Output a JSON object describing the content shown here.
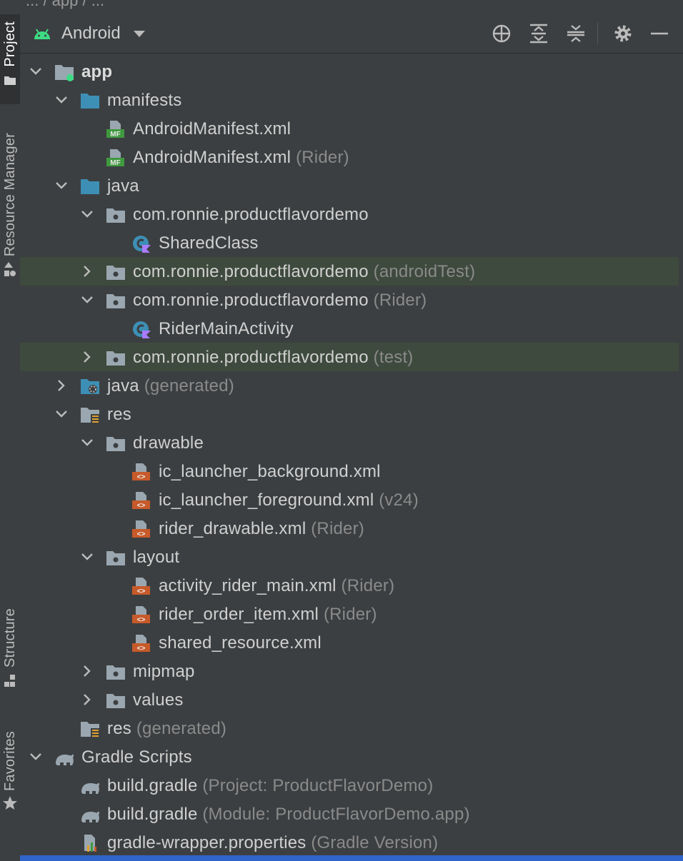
{
  "sidebar": {
    "tabs": [
      {
        "label": "Project",
        "icon": "folder-icon",
        "active": true
      },
      {
        "label": "Resource Manager",
        "icon": "resource-manager-icon",
        "active": false
      },
      {
        "label": "Structure",
        "icon": "structure-icon",
        "active": false
      },
      {
        "label": "Favorites",
        "icon": "star-icon",
        "active": false
      }
    ]
  },
  "breadcrumb": {
    "text": "... / app / ..."
  },
  "header": {
    "view_mode": "Android",
    "icons": [
      "locate-icon",
      "expand-all-icon",
      "collapse-all-icon",
      "settings-icon",
      "minimize-icon"
    ]
  },
  "tree": {
    "rows": [
      {
        "label": "app",
        "hint": "",
        "expanded": true,
        "bold": true,
        "icon": "module-folder-icon"
      },
      {
        "label": "manifests",
        "hint": "",
        "expanded": true,
        "icon": "folder-icon"
      },
      {
        "label": "AndroidManifest.xml",
        "hint": "",
        "icon": "manifest-file-icon"
      },
      {
        "label": "AndroidManifest.xml",
        "hint": "(Rider)",
        "icon": "manifest-file-icon"
      },
      {
        "label": "java",
        "hint": "",
        "expanded": true,
        "icon": "folder-icon"
      },
      {
        "label": "com.ronnie.productflavordemo",
        "hint": "",
        "expanded": true,
        "icon": "package-icon"
      },
      {
        "label": "SharedClass",
        "hint": "",
        "icon": "kotlin-class-icon"
      },
      {
        "label": "com.ronnie.productflavordemo",
        "hint": "(androidTest)",
        "expanded": false,
        "icon": "package-icon",
        "highlight": true
      },
      {
        "label": "com.ronnie.productflavordemo",
        "hint": "(Rider)",
        "expanded": true,
        "icon": "package-icon"
      },
      {
        "label": "RiderMainActivity",
        "hint": "",
        "icon": "kotlin-class-icon"
      },
      {
        "label": "com.ronnie.productflavordemo",
        "hint": "(test)",
        "expanded": false,
        "icon": "package-icon",
        "highlight": true
      },
      {
        "label": "java",
        "hint": "(generated)",
        "expanded": false,
        "icon": "generated-folder-icon"
      },
      {
        "label": "res",
        "hint": "",
        "expanded": true,
        "icon": "resource-folder-icon"
      },
      {
        "label": "drawable",
        "hint": "",
        "expanded": true,
        "icon": "package-icon"
      },
      {
        "label": "ic_launcher_background.xml",
        "hint": "",
        "icon": "xml-file-icon"
      },
      {
        "label": "ic_launcher_foreground.xml",
        "hint": "(v24)",
        "icon": "xml-file-icon"
      },
      {
        "label": "rider_drawable.xml",
        "hint": "(Rider)",
        "icon": "xml-file-icon"
      },
      {
        "label": "layout",
        "hint": "",
        "expanded": true,
        "icon": "package-icon"
      },
      {
        "label": "activity_rider_main.xml",
        "hint": "(Rider)",
        "icon": "xml-file-icon"
      },
      {
        "label": "rider_order_item.xml",
        "hint": "(Rider)",
        "icon": "xml-file-icon"
      },
      {
        "label": "shared_resource.xml",
        "hint": "",
        "icon": "xml-file-icon"
      },
      {
        "label": "mipmap",
        "hint": "",
        "expanded": false,
        "icon": "package-icon"
      },
      {
        "label": "values",
        "hint": "",
        "expanded": false,
        "icon": "package-icon"
      },
      {
        "label": "res",
        "hint": "(generated)",
        "icon": "resource-folder-icon"
      },
      {
        "label": "Gradle Scripts",
        "hint": "",
        "expanded": true,
        "icon": "gradle-icon"
      },
      {
        "label": "build.gradle",
        "hint": "(Project: ProductFlavorDemo)",
        "icon": "gradle-icon"
      },
      {
        "label": "build.gradle",
        "hint": "(Module: ProductFlavorDemo.app)",
        "icon": "gradle-icon"
      },
      {
        "label": "gradle-wrapper.properties",
        "hint": "(Gradle Version)",
        "icon": "properties-file-icon"
      }
    ]
  },
  "colors": {
    "background": "#3c3f41",
    "highlight_row": "#3e4a3d",
    "selection": "#2f65ca",
    "folder_blue": "#3d8fb5",
    "android_green": "#3ddc84",
    "xml_orange": "#c75a2a",
    "manifest_green": "#3f9a3f",
    "kotlin_purple": "#a97bff"
  }
}
